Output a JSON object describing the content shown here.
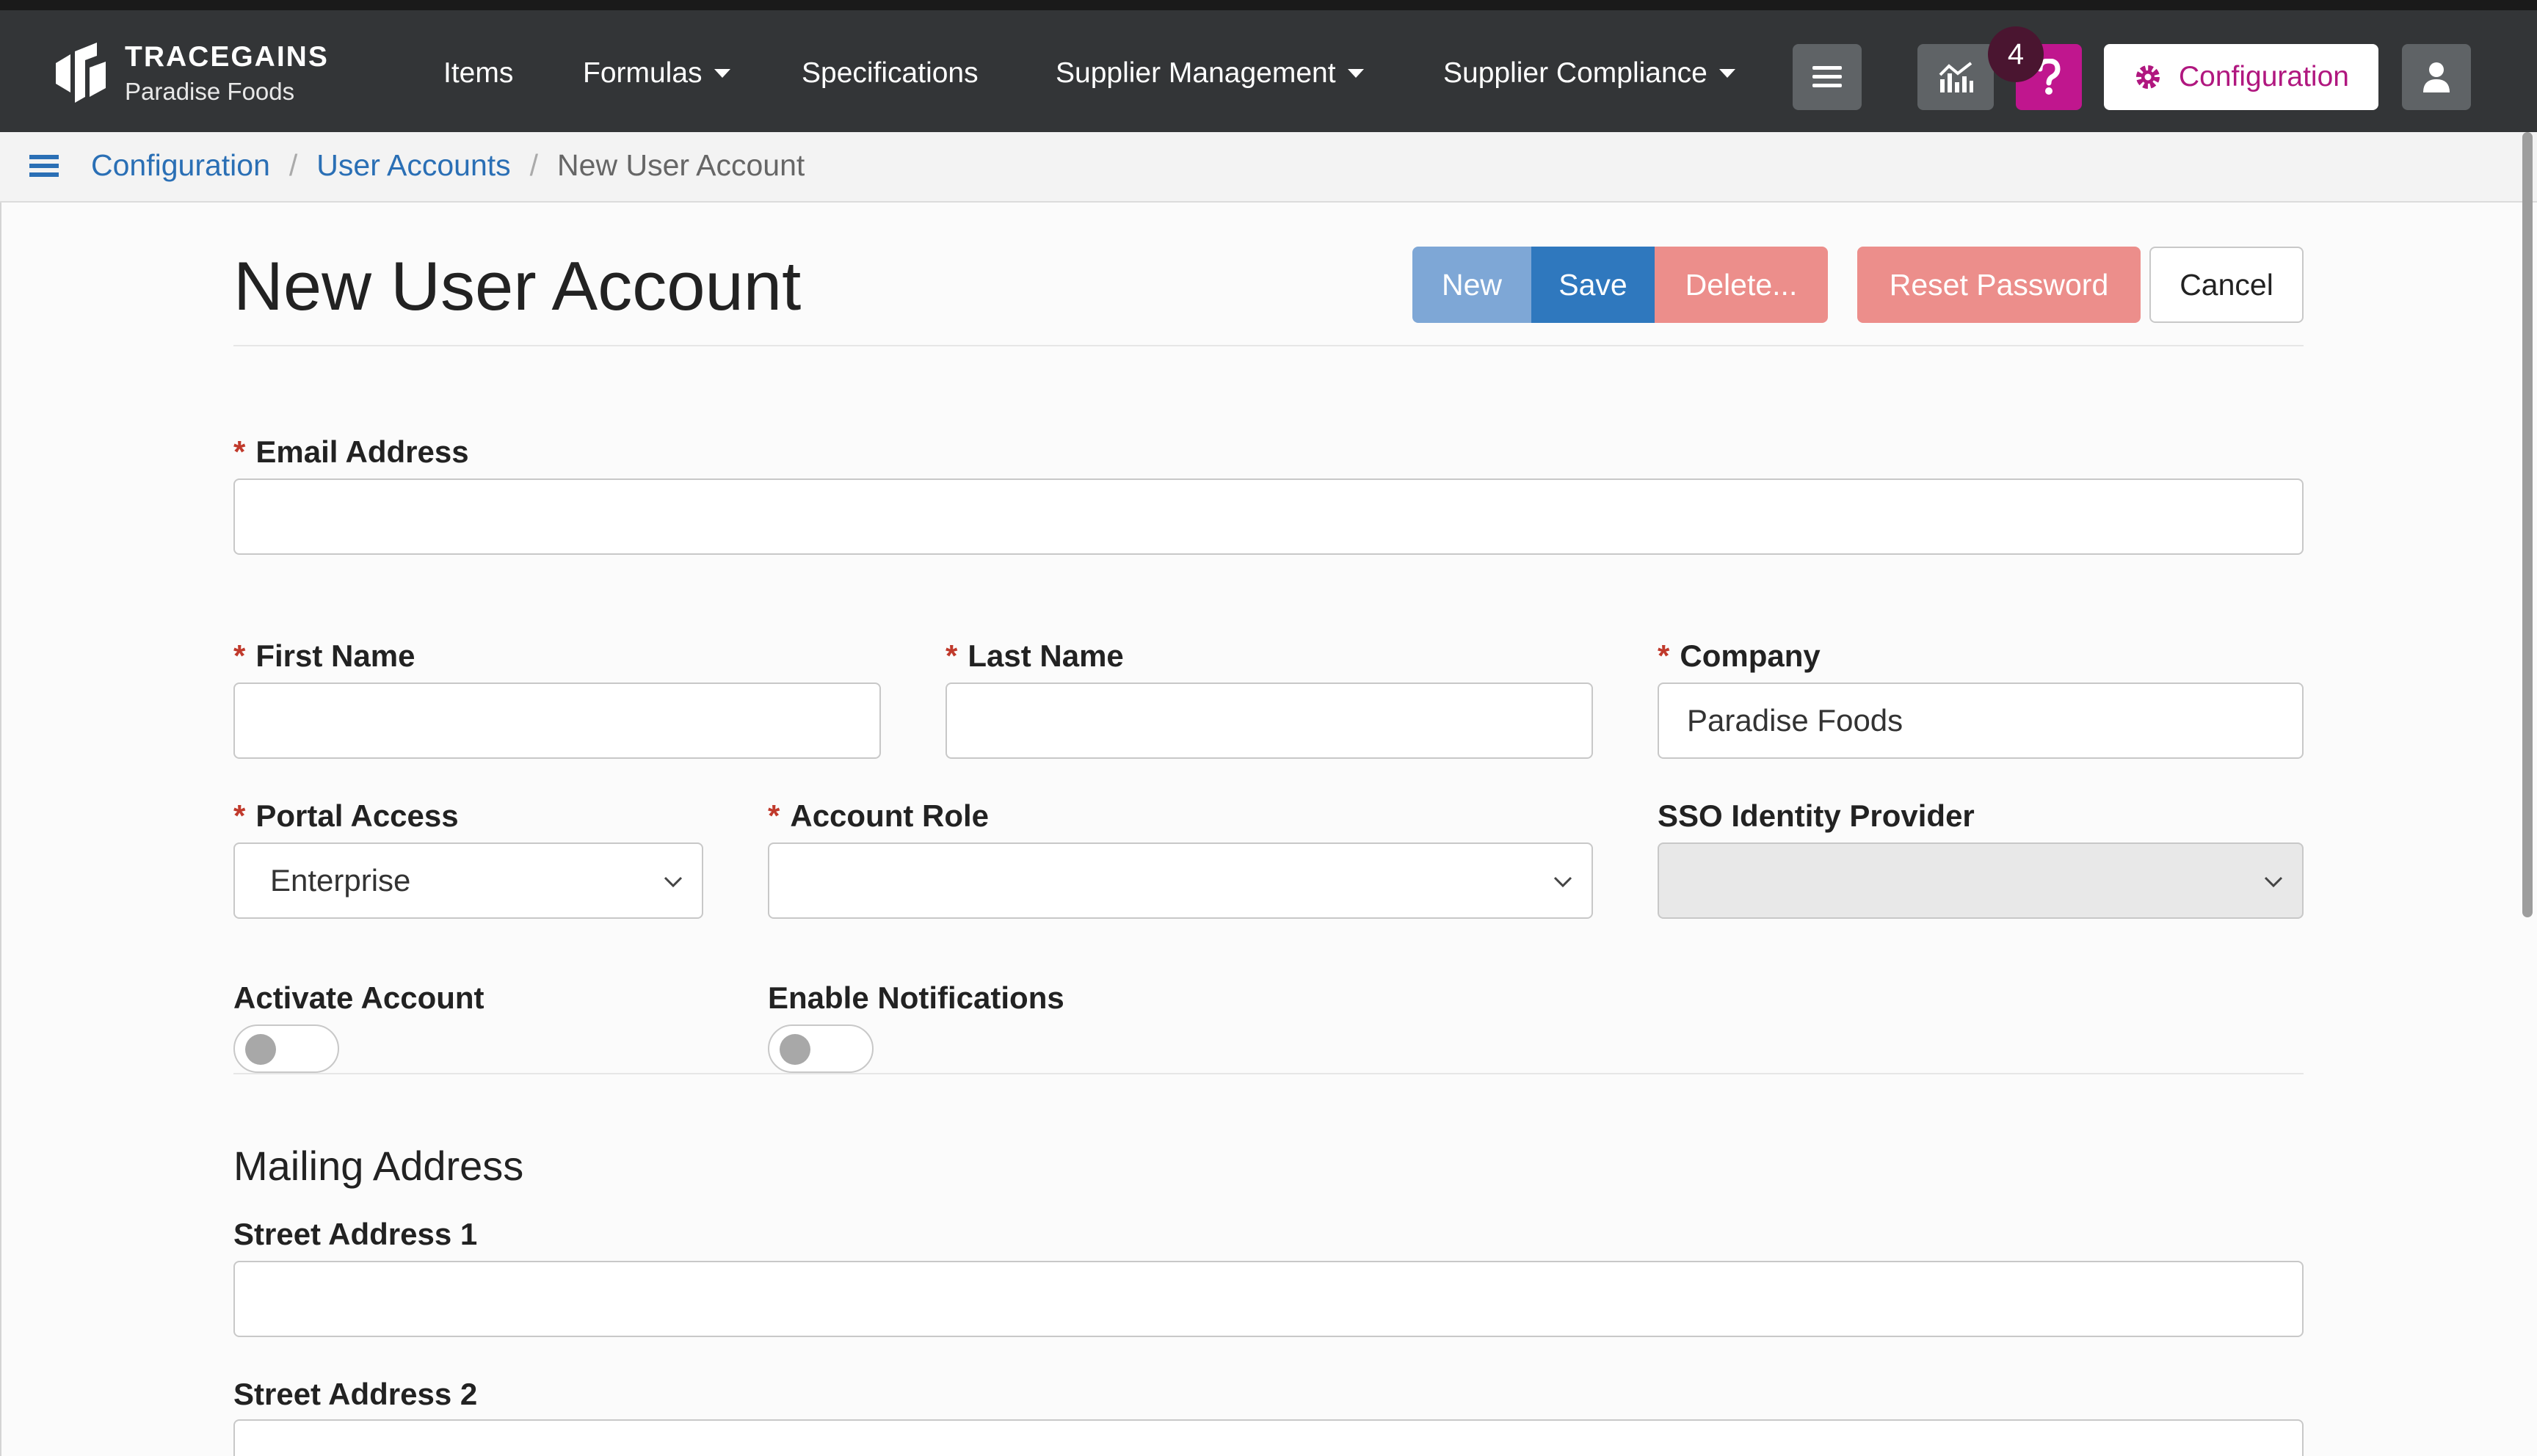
{
  "brand": {
    "name": "TRACEGAINS",
    "org": "Paradise Foods"
  },
  "nav": {
    "items": [
      {
        "label": "Items"
      },
      {
        "label": "Formulas"
      },
      {
        "label": "Specifications"
      },
      {
        "label": "Supplier Management"
      },
      {
        "label": "Supplier Compliance"
      }
    ],
    "notification_count": "4",
    "config_label": "Configuration",
    "icons": [
      "hamburger-icon",
      "analytics-icon",
      "help-icon",
      "gear-icon",
      "user-icon"
    ]
  },
  "breadcrumb": {
    "items": [
      "Configuration",
      "User Accounts"
    ],
    "current": "New User Account"
  },
  "page": {
    "title": "New User Account",
    "actions": {
      "new": "New",
      "save": "Save",
      "delete": "Delete...",
      "reset": "Reset Password",
      "cancel": "Cancel"
    }
  },
  "form": {
    "email": {
      "label": "Email Address",
      "value": ""
    },
    "first_name": {
      "label": "First Name",
      "value": ""
    },
    "last_name": {
      "label": "Last Name",
      "value": ""
    },
    "company": {
      "label": "Company",
      "value": "Paradise Foods"
    },
    "portal_access": {
      "label": "Portal Access",
      "value": "Enterprise"
    },
    "account_role": {
      "label": "Account Role",
      "value": ""
    },
    "sso": {
      "label": "SSO Identity Provider",
      "value": ""
    },
    "activate": {
      "label": "Activate Account",
      "on": false
    },
    "notifications": {
      "label": "Enable Notifications",
      "on": false
    }
  },
  "mailing": {
    "title": "Mailing Address",
    "street1": {
      "label": "Street Address 1",
      "value": ""
    },
    "street2": {
      "label": "Street Address 2",
      "value": ""
    }
  },
  "colors": {
    "navbar": "#333537",
    "link": "#2a6fb5",
    "new_button": "#7ea7d6",
    "save_button": "#2f78be",
    "danger_button": "#ec8e8b",
    "help_button": "#c0168e",
    "config_text": "#b0177f"
  }
}
